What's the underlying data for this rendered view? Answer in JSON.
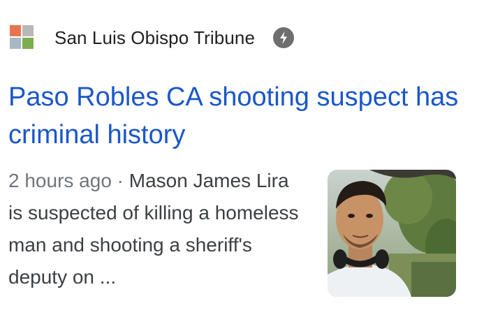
{
  "source": {
    "name": "San Luis Obispo Tribune",
    "logo_icon": "slo-tribune-grid-logo-icon",
    "logo_colors": {
      "top_left": "#e8744f",
      "top_right": "#b8b8b8",
      "bottom_left": "#a9b6c4",
      "bottom_right": "#7cae4f"
    },
    "amp_icon": "lightning-bolt-icon"
  },
  "article": {
    "headline": "Paso Robles CA shooting suspect has criminal history",
    "time": "2 hours ago",
    "separator": "·",
    "snippet": "Mason James Lira is suspected of killing a homeless man and shooting a sheriff's deputy on ..."
  },
  "thumbnail": {
    "description_icon": "suspect-photo-thumbnail"
  },
  "colors": {
    "headline": "#1a57c9",
    "source_text": "#202124",
    "snippet_text": "#3c4043",
    "meta_text": "#70757a",
    "amp_badge": "#6e6e6e"
  }
}
